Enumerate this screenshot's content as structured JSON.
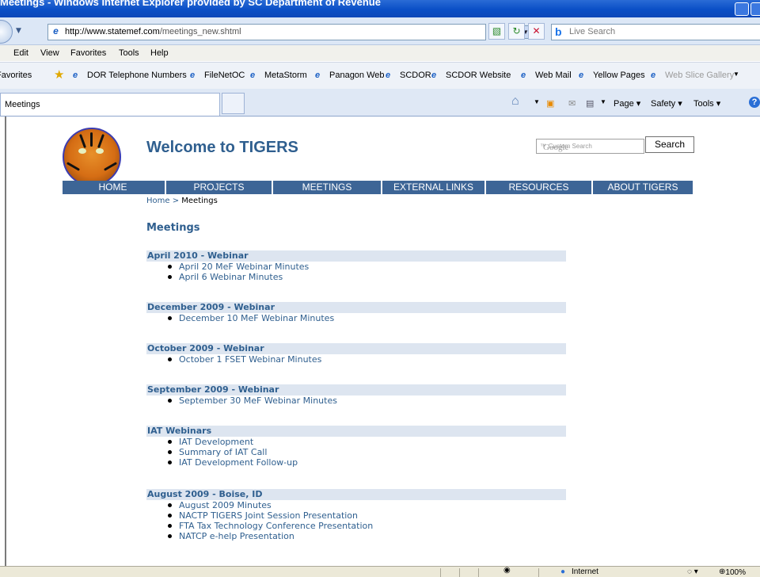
{
  "window": {
    "title": "Meetings - Windows Internet Explorer provided by SC Department of Revenue"
  },
  "address": {
    "url_host": "http://www.statemef.com",
    "url_path": "/meetings_new.shtml",
    "search_placeholder": "Live Search"
  },
  "menu": [
    "Edit",
    "View",
    "Favorites",
    "Tools",
    "Help"
  ],
  "favorites": {
    "label": "Favorites",
    "items": [
      "DOR Telephone Numbers",
      "FileNetOC",
      "MetaStorm",
      "Panagon Web",
      "SCDOR",
      "SCDOR Website",
      "Web Mail",
      "Yellow Pages",
      "Web Slice Gallery"
    ]
  },
  "tab": {
    "label": "Meetings"
  },
  "commands": {
    "page": "Page",
    "safety": "Safety",
    "tools": "Tools"
  },
  "site": {
    "title": "Welcome to TIGERS",
    "search_placeholder": "Google",
    "search_suffix": "Custom Search",
    "search_button": "Search",
    "nav": [
      "HOME",
      "PROJECTS",
      "MEETINGS",
      "EXTERNAL LINKS",
      "RESOURCES",
      "ABOUT TIGERS"
    ],
    "breadcrumb_home": "Home",
    "breadcrumb_sep": " > ",
    "breadcrumb_current": "Meetings",
    "heading": "Meetings"
  },
  "sections": [
    {
      "title": "April 2010 - Webinar",
      "links": [
        "April 20 MeF Webinar Minutes",
        "April 6 Webinar Minutes"
      ]
    },
    {
      "title": "December 2009 - Webinar",
      "links": [
        "December 10 MeF Webinar Minutes"
      ]
    },
    {
      "title": "October 2009 - Webinar",
      "links": [
        "October 1 FSET Webinar Minutes"
      ]
    },
    {
      "title": "September 2009 - Webinar",
      "links": [
        "September 30 MeF Webinar Minutes"
      ]
    },
    {
      "title": "IAT Webinars",
      "links": [
        "IAT Development",
        "Summary of IAT Call",
        "IAT Development Follow-up"
      ]
    },
    {
      "title": "August 2009 - Boise, ID",
      "links": [
        "August 2009 Minutes",
        "NACTP TIGERS Joint Session Presentation",
        "FTA Tax Technology Conference Presentation",
        "NATCP e-help Presentation"
      ]
    }
  ],
  "status": {
    "zone": "Internet",
    "zoom": "100%"
  },
  "colors": {
    "nav_bg": "#3d6596",
    "link": "#2f5f8f",
    "section_header_bg": "#dde5f0"
  }
}
